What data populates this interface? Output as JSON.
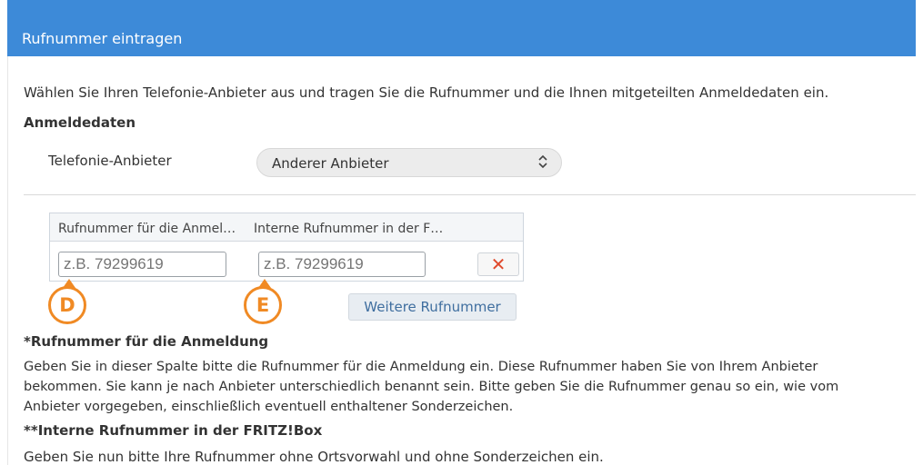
{
  "dialog": {
    "title": "Rufnummer eintragen",
    "intro": "Wählen Sie Ihren Telefonie-Anbieter aus und tragen Sie die Rufnummer und die Ihnen mitgeteilten Anmeldedaten ein.",
    "section_heading": "Anmeldedaten",
    "provider_label": "Telefonie-Anbieter",
    "provider_value": "Anderer Anbieter",
    "columns": [
      "Rufnummer für die Anmel…",
      "Interne Rufnummer in der F…"
    ],
    "number_placeholder": "z.B. 79299619",
    "internal_placeholder": "z.B. 79299619",
    "delete_symbol": "✕",
    "more_button": "Weitere Rufnummer",
    "marker_d": "D",
    "marker_e": "E",
    "note1_heading": "*Rufnummer für die Anmeldung",
    "note1_line1": "Geben Sie in dieser Spalte bitte die Rufnummer für die Anmeldung ein. Diese Rufnummer haben Sie von Ihrem Anbieter",
    "note1_line2": "bekommen. Sie kann je nach Anbieter unterschiedlich benannt sein. Bitte geben Sie die Rufnummer genau so ein, wie vom",
    "note1_line3": "Anbieter vorgegeben, einschließlich eventuell enthaltener Sonderzeichen.",
    "note2_heading": "**Interne Rufnummer in der FRITZ!Box",
    "note2_text": "Geben Sie nun bitte Ihre Rufnummer ohne Ortsvorwahl und ohne Sonderzeichen ein."
  },
  "colors": {
    "accent": "#3d8ad8",
    "marker": "#f08a24",
    "delete": "#e04a2d"
  },
  "icons": {
    "select": "chevron-updown-icon",
    "delete": "close-icon"
  }
}
